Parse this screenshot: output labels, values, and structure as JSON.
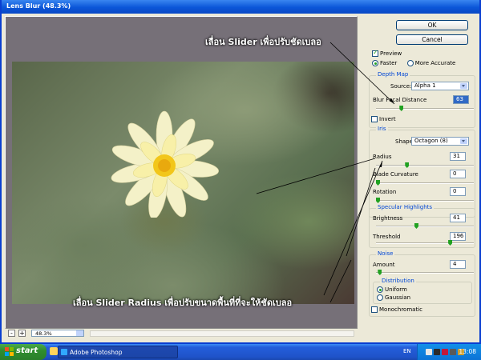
{
  "window": {
    "title": "Lens Blur (48.3%)"
  },
  "annotations": {
    "top": "เลื่อน Slider เพื่อปรับชัดเบลอ",
    "bottom": "เลื่อน Slider Radius เพื่อปรับขนาดพื้นที่ที่จะให้ชัดเบลอ"
  },
  "zoom": {
    "minus": "-",
    "plus": "+",
    "value": "48.3%"
  },
  "buttons": {
    "ok": "OK",
    "cancel": "Cancel"
  },
  "preview": {
    "label": "Preview",
    "checked": true,
    "faster": "Faster",
    "more_accurate": "More Accurate",
    "selected": "Faster"
  },
  "depth_map": {
    "title": "Depth Map",
    "source_label": "Source:",
    "source_value": "Alpha 1",
    "blur_focal_label": "Blur Focal Distance",
    "blur_focal_value": "63",
    "blur_focal_fraction": 0.25,
    "invert_label": "Invert"
  },
  "iris": {
    "title": "Iris",
    "shape_label": "Shape:",
    "shape_value": "Octagon (8)",
    "radius_label": "Radius",
    "radius_value": "31",
    "radius_fraction": 0.31,
    "curvature_label": "Blade Curvature",
    "curvature_value": "0",
    "curvature_fraction": 0.0,
    "rotation_label": "Rotation",
    "rotation_value": "0",
    "rotation_fraction": 0.0
  },
  "specular": {
    "title": "Specular Highlights",
    "brightness_label": "Brightness",
    "brightness_value": "41",
    "brightness_fraction": 0.41,
    "threshold_label": "Threshold",
    "threshold_value": "196",
    "threshold_fraction": 0.77
  },
  "noise": {
    "title": "Noise",
    "amount_label": "Amount",
    "amount_value": "4",
    "amount_fraction": 0.02,
    "distribution_title": "Distribution",
    "uniform": "Uniform",
    "gaussian": "Gaussian",
    "selected": "Uniform",
    "monochromatic_label": "Monochromatic"
  },
  "taskbar": {
    "start": "start",
    "task": "Adobe Photoshop",
    "lang": "EN",
    "clock": "13:08"
  },
  "colors": {
    "accent": "#0046d5",
    "thumb": "#21a121",
    "title_bar": "#0b56d8",
    "taskbar": "#245edb"
  }
}
